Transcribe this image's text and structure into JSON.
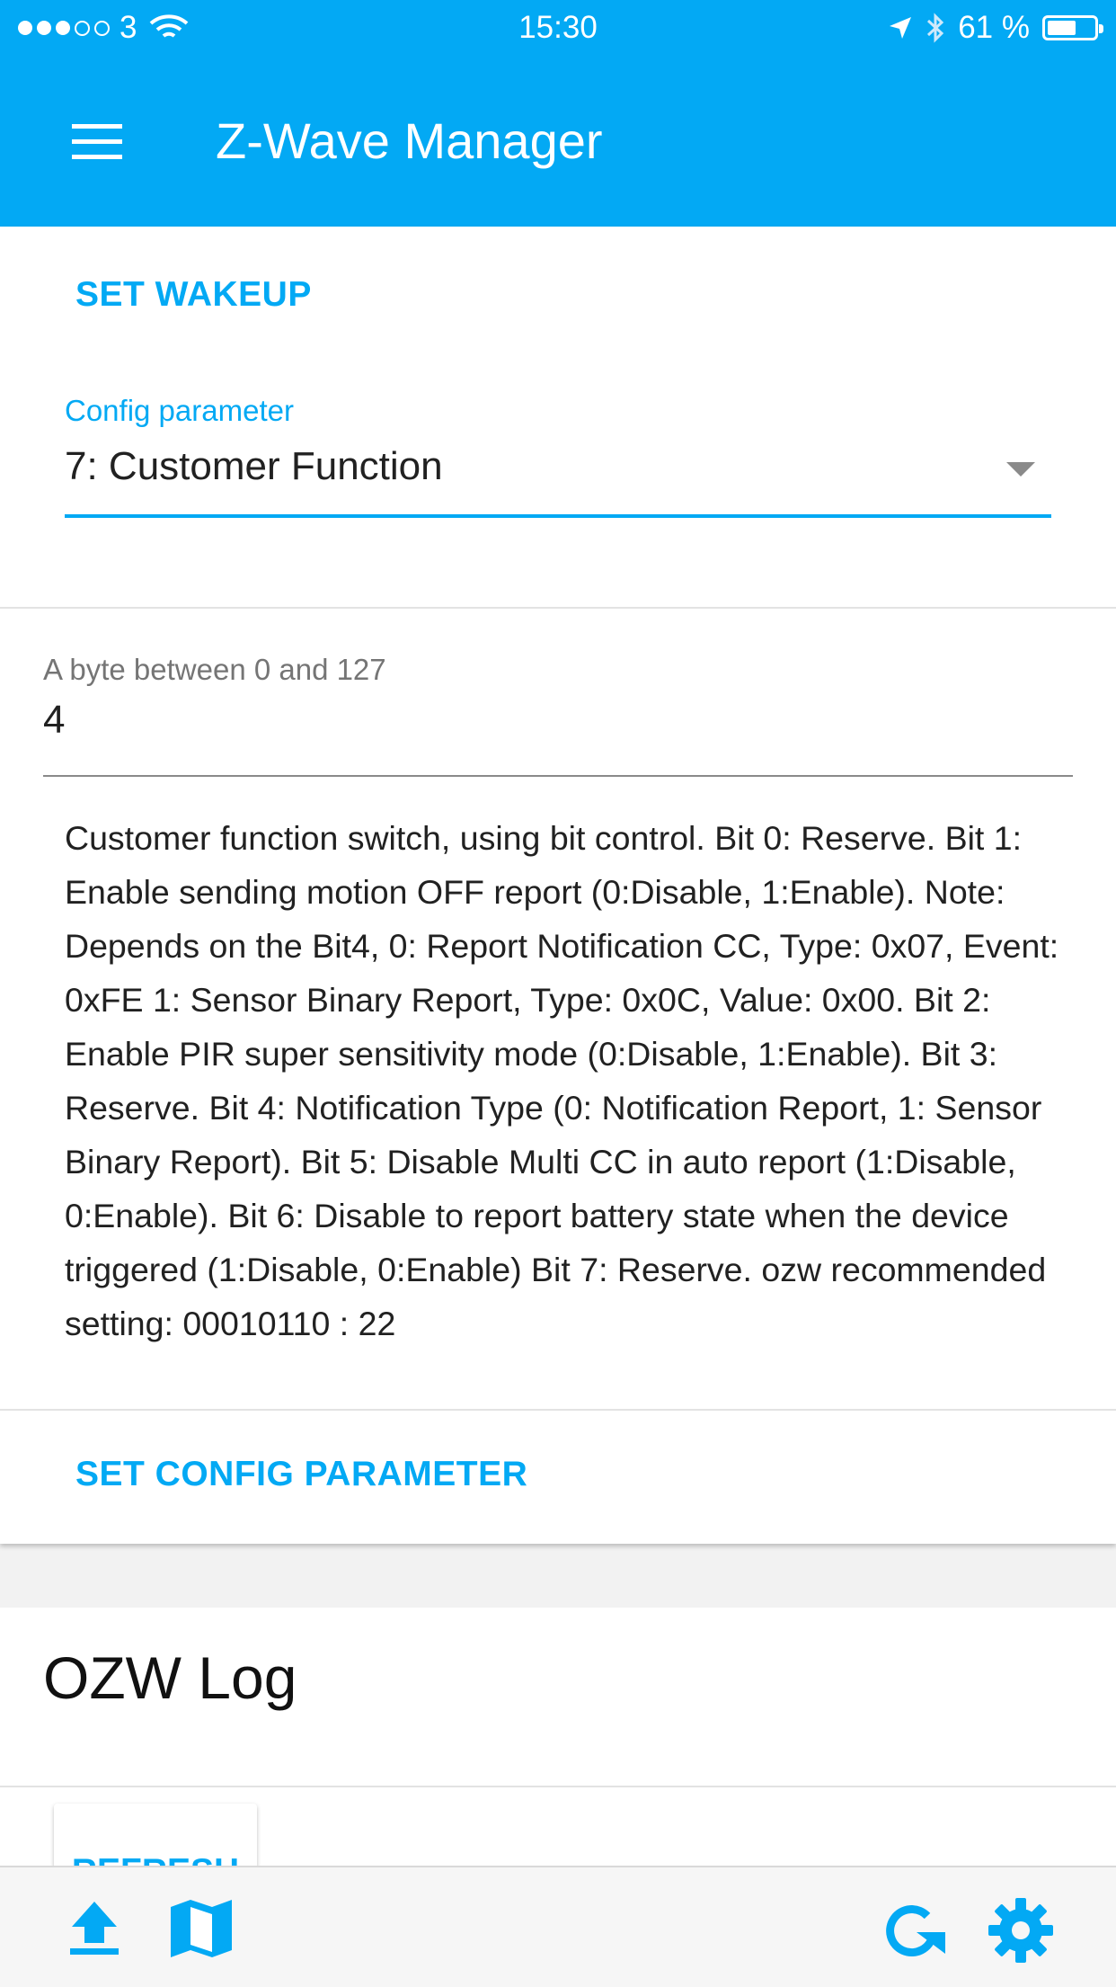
{
  "status_bar": {
    "carrier": "3",
    "time": "15:30",
    "battery_percent": "61 %",
    "battery_level": 0.61,
    "signal_bars_filled": 3,
    "signal_bars_total": 5,
    "icons": [
      "wifi-icon",
      "location-arrow-icon",
      "bluetooth-icon",
      "battery-icon"
    ]
  },
  "app_bar": {
    "title": "Z-Wave Manager",
    "menu_icon": "hamburger-menu-icon",
    "color": "#03a9f4"
  },
  "wakeup": {
    "button_label": "SET WAKEUP"
  },
  "config_select": {
    "label": "Config parameter",
    "selected": "7: Customer Function"
  },
  "value_input": {
    "label": "A byte between 0 and 127",
    "value": "4"
  },
  "description": "Customer function switch, using bit control. Bit 0: Reserve. Bit 1: Enable sending motion OFF report (0:Disable, 1:Enable). Note: Depends on the Bit4, 0: Report Notification CC, Type: 0x07, Event: 0xFE 1: Sensor Binary Report, Type: 0x0C, Value: 0x00. Bit 2: Enable PIR super sensitivity mode (0:Disable, 1:Enable). Bit 3: Reserve. Bit 4: Notification Type (0: Notification Report, 1: Sensor Binary Report). Bit 5: Disable Multi CC in auto report (1:Disable, 0:Enable). Bit 6: Disable to report battery state when the device triggered (1:Disable, 0:Enable) Bit 7: Reserve. ozw recommended setting: 00010110 : 22",
  "set_config": {
    "button_label": "SET CONFIG PARAMETER"
  },
  "ozw_log": {
    "title": "OZW Log",
    "refresh_label": "REFRESH"
  },
  "bottom_bar": {
    "icons": [
      "upload-icon",
      "map-icon",
      "refresh-icon",
      "settings-gear-icon"
    ]
  }
}
